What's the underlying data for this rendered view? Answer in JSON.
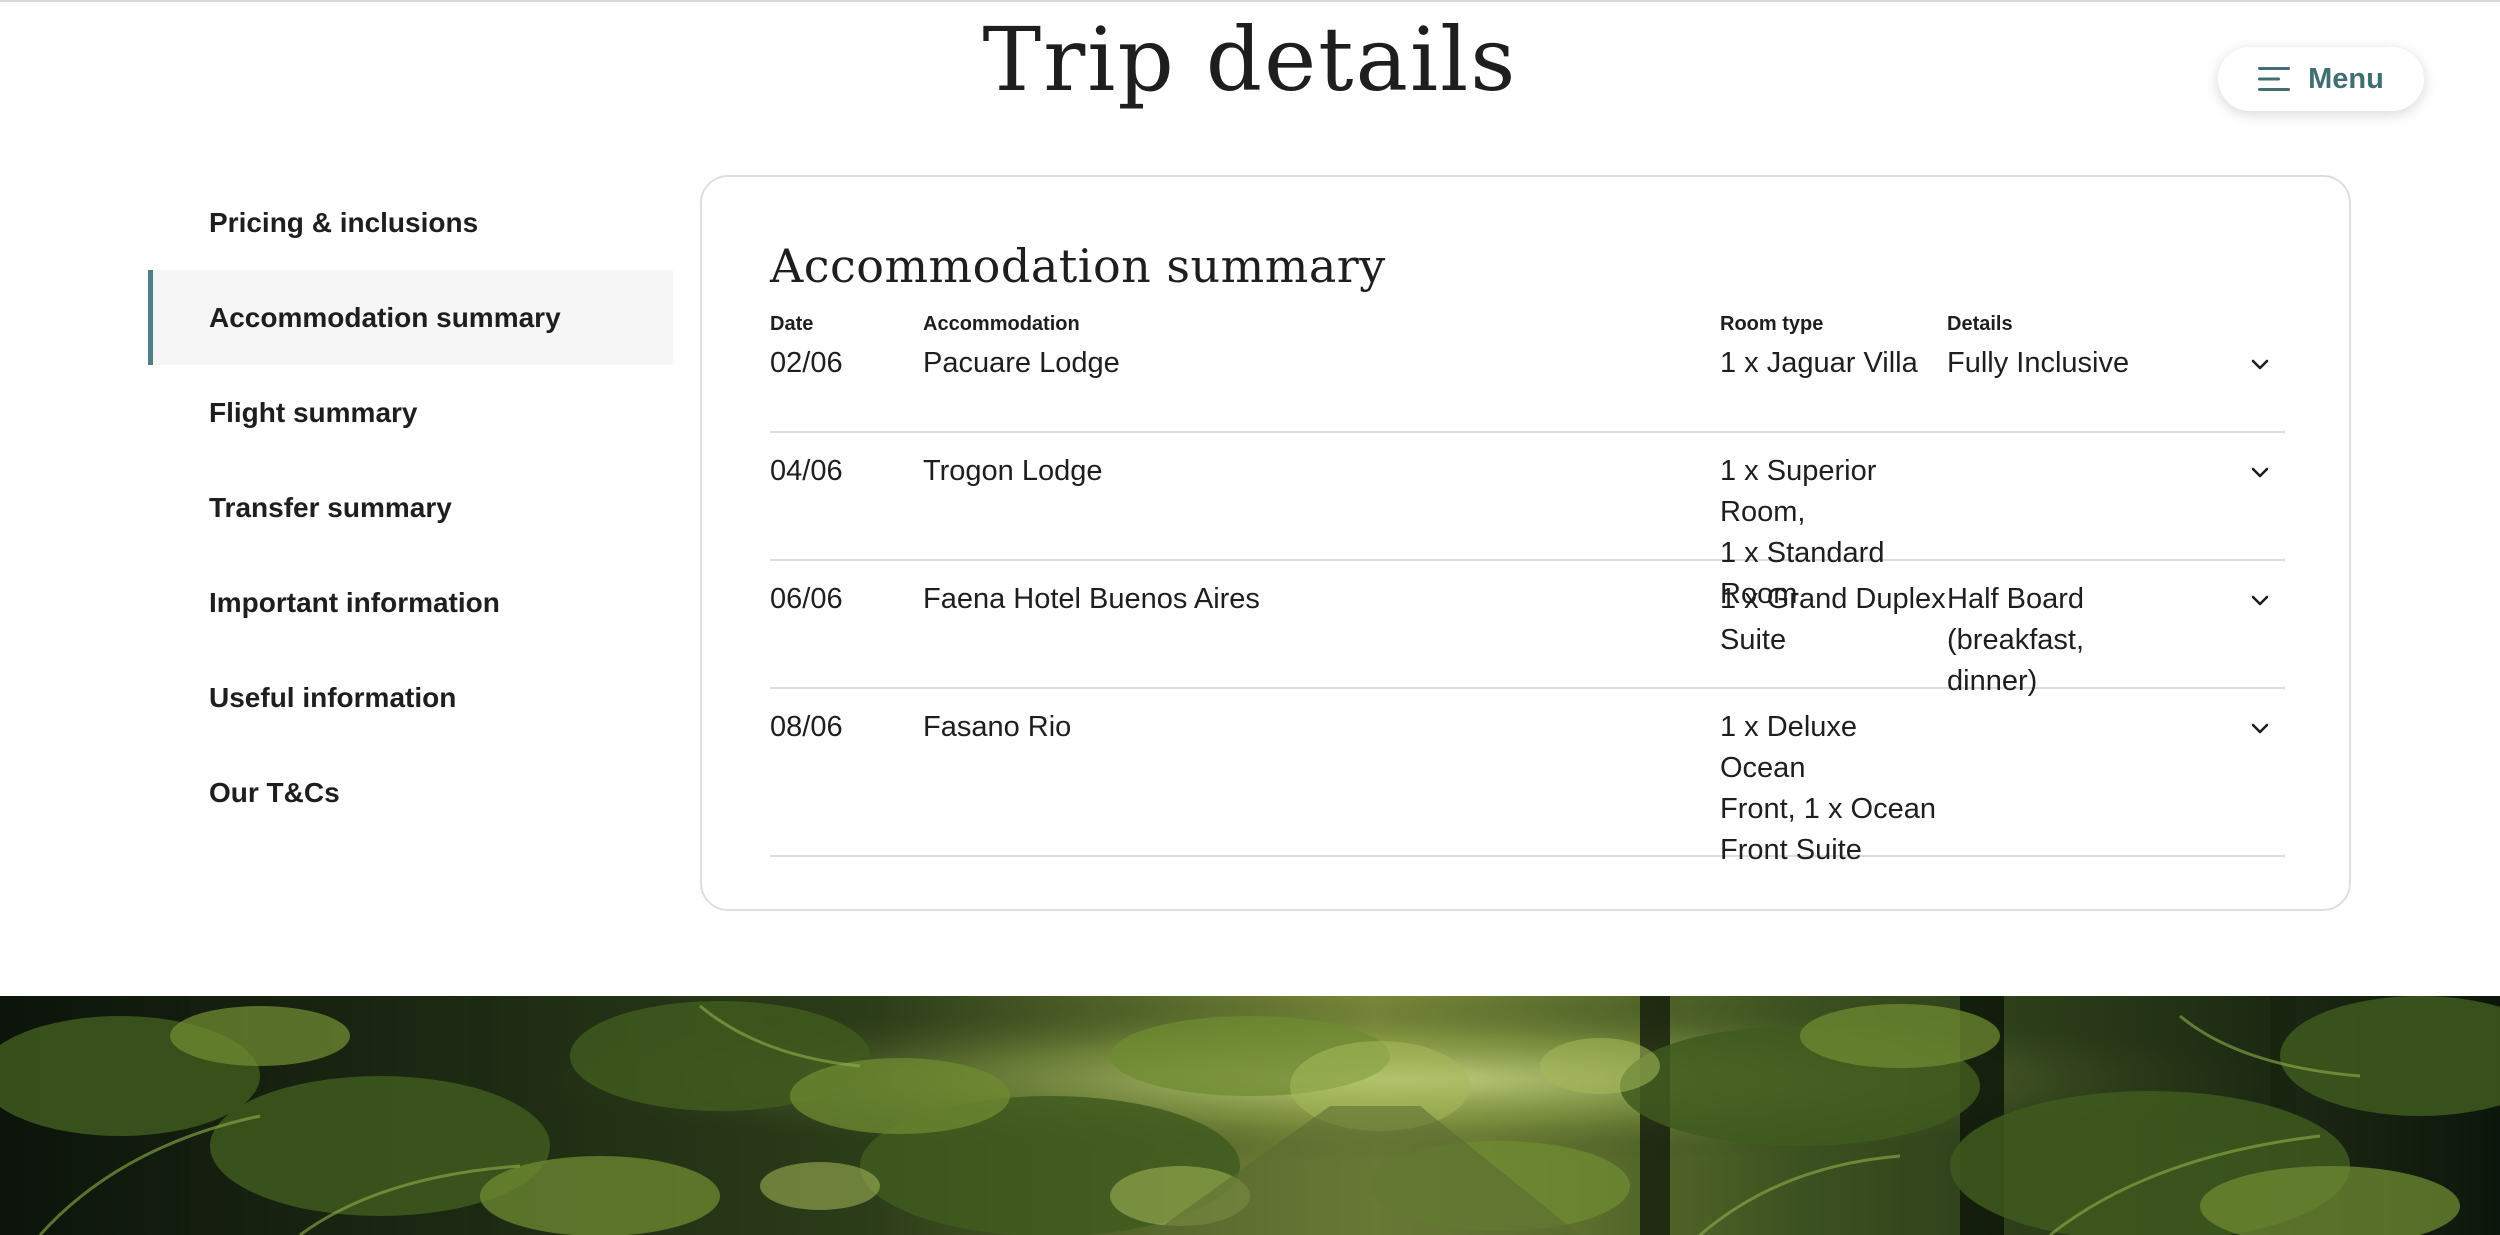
{
  "page": {
    "title": "Trip details"
  },
  "menu": {
    "label": "Menu",
    "icon": "hamburger-menu-icon",
    "accent": "#3f6f72"
  },
  "sidebar": {
    "active_index": 1,
    "accent": "#4a7f84",
    "items": [
      {
        "label": "Pricing & inclusions"
      },
      {
        "label": "Accommodation summary"
      },
      {
        "label": "Flight summary"
      },
      {
        "label": "Transfer summary"
      },
      {
        "label": "Important information"
      },
      {
        "label": "Useful information"
      },
      {
        "label": "Our T&Cs"
      }
    ]
  },
  "accommodation": {
    "title": "Accommodation summary",
    "headers": {
      "date": "Date",
      "accommodation": "Accommodation",
      "room_type": "Room type",
      "details": "Details"
    },
    "rows": [
      {
        "date": "02/06",
        "accommodation": "Pacuare Lodge",
        "room_lines": [
          "1 x Jaguar Villa"
        ],
        "details_lines": [
          "Fully Inclusive"
        ]
      },
      {
        "date": "04/06",
        "accommodation": "Trogon Lodge",
        "room_lines": [
          "1 x Superior Room,",
          "1 x Standard Room"
        ],
        "details_lines": []
      },
      {
        "date": "06/06",
        "accommodation": "Faena Hotel Buenos Aires",
        "room_lines": [
          "1 x Grand Duplex",
          "Suite"
        ],
        "details_lines": [
          "Half Board (breakfast,",
          "dinner)"
        ]
      },
      {
        "date": "08/06",
        "accommodation": "Fasano Rio",
        "room_lines": [
          "1 x Deluxe Ocean",
          "Front, 1 x Ocean",
          "Front Suite"
        ],
        "details_lines": []
      }
    ],
    "expand_icon": "chevron-down-icon"
  },
  "hero": {
    "subject": "rainforest-photo"
  }
}
